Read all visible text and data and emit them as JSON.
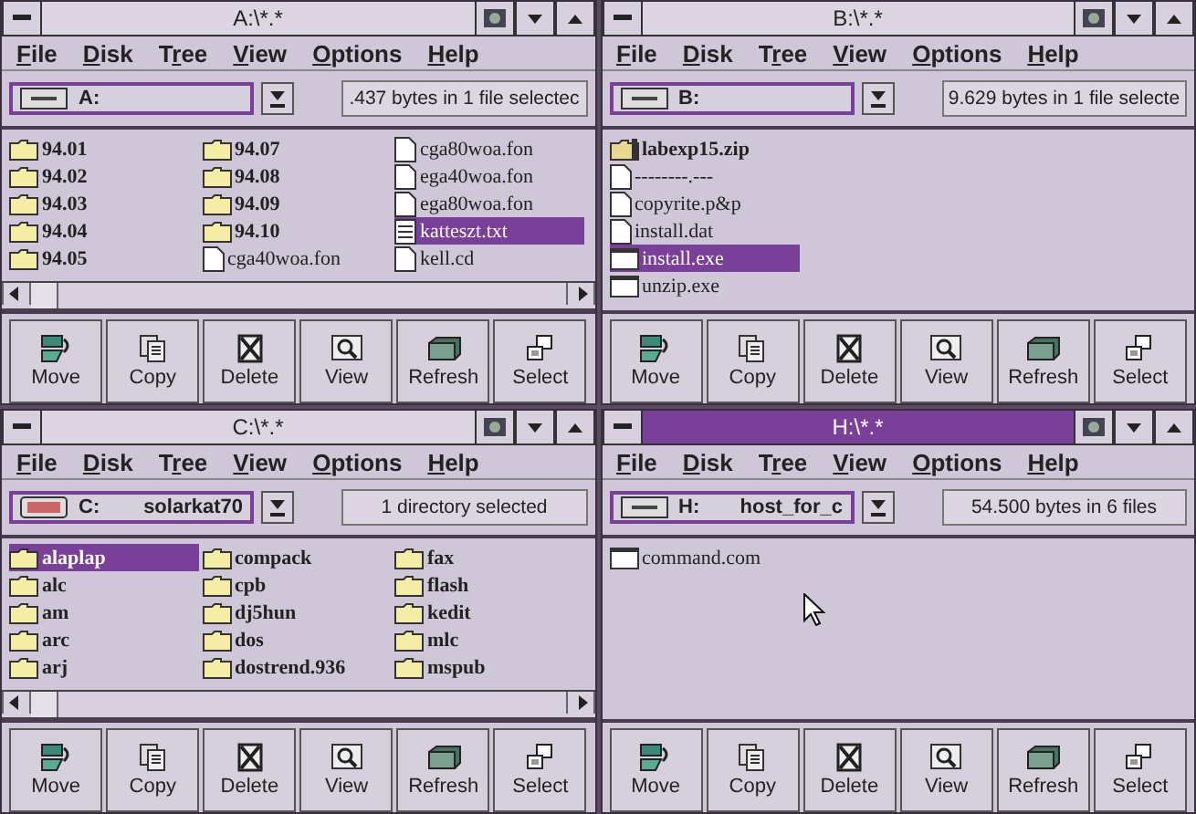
{
  "panes": [
    {
      "title": "A:\\*.*",
      "active": false,
      "menu": [
        {
          "key": "F",
          "post": "ile"
        },
        {
          "key": "D",
          "post": "isk"
        },
        {
          "pre": "T",
          "key": "r",
          "post": "ee"
        },
        {
          "key": "V",
          "post": "iew"
        },
        {
          "key": "O",
          "post": "ptions"
        },
        {
          "key": "H",
          "post": "elp"
        }
      ],
      "drive": {
        "letter": "A:",
        "kind": "floppy"
      },
      "status": ".437 bytes in 1 file selectec",
      "scrollbar": true,
      "pointer": false,
      "files": [
        {
          "name": "94.01",
          "kind": "folder",
          "selected": false
        },
        {
          "name": "94.02",
          "kind": "folder",
          "selected": false
        },
        {
          "name": "94.03",
          "kind": "folder",
          "selected": false
        },
        {
          "name": "94.04",
          "kind": "folder",
          "selected": false
        },
        {
          "name": "94.05",
          "kind": "folder",
          "selected": false
        },
        {
          "name": "94.07",
          "kind": "folder",
          "selected": false
        },
        {
          "name": "94.08",
          "kind": "folder",
          "selected": false
        },
        {
          "name": "94.09",
          "kind": "folder",
          "selected": false
        },
        {
          "name": "94.10",
          "kind": "folder",
          "selected": false
        },
        {
          "name": "cga40woa.fon",
          "kind": "doc",
          "selected": false
        },
        {
          "name": "cga80woa.fon",
          "kind": "doc",
          "selected": false
        },
        {
          "name": "ega40woa.fon",
          "kind": "doc",
          "selected": false
        },
        {
          "name": "ega80woa.fon",
          "kind": "doc",
          "selected": false
        },
        {
          "name": "katteszt.txt",
          "kind": "text",
          "selected": true
        },
        {
          "name": "kell.cd",
          "kind": "doc",
          "selected": false
        }
      ],
      "buttons": [
        "Move",
        "Copy",
        "Delete",
        "View",
        "Refresh",
        "Select"
      ]
    },
    {
      "title": "B:\\*.*",
      "active": false,
      "menu": [
        {
          "key": "F",
          "post": "ile"
        },
        {
          "key": "D",
          "post": "isk"
        },
        {
          "pre": "T",
          "key": "r",
          "post": "ee"
        },
        {
          "key": "V",
          "post": "iew"
        },
        {
          "key": "O",
          "post": "ptions"
        },
        {
          "key": "H",
          "post": "elp"
        }
      ],
      "drive": {
        "letter": "B:",
        "kind": "floppy"
      },
      "status": "9.629 bytes in 1 file selecte",
      "scrollbar": false,
      "pointer": false,
      "files": [
        {
          "name": "labexp15.zip",
          "kind": "zip",
          "selected": false
        },
        {
          "name": "--------.---",
          "kind": "doc",
          "selected": false
        },
        {
          "name": "copyrite.p&p",
          "kind": "doc",
          "selected": false
        },
        {
          "name": "install.dat",
          "kind": "doc",
          "selected": false
        },
        {
          "name": "install.exe",
          "kind": "exe",
          "selected": true
        },
        {
          "name": "unzip.exe",
          "kind": "exe",
          "selected": false
        }
      ],
      "buttons": [
        "Move",
        "Copy",
        "Delete",
        "View",
        "Refresh",
        "Select"
      ]
    },
    {
      "title": "C:\\*.*",
      "active": false,
      "menu": [
        {
          "key": "F",
          "post": "ile"
        },
        {
          "key": "D",
          "post": "isk"
        },
        {
          "pre": "T",
          "key": "r",
          "post": "ee"
        },
        {
          "key": "V",
          "post": "iew"
        },
        {
          "key": "O",
          "post": "ptions"
        },
        {
          "key": "H",
          "post": "elp"
        }
      ],
      "drive": {
        "letter": "C:",
        "label": "solarkat70",
        "kind": "network"
      },
      "status": "1 directory selected",
      "scrollbar": true,
      "pointer": false,
      "files": [
        {
          "name": "alaplap",
          "kind": "folder",
          "selected": true
        },
        {
          "name": "alc",
          "kind": "folder",
          "selected": false
        },
        {
          "name": "am",
          "kind": "folder",
          "selected": false
        },
        {
          "name": "arc",
          "kind": "folder",
          "selected": false
        },
        {
          "name": "arj",
          "kind": "folder",
          "selected": false
        },
        {
          "name": "compack",
          "kind": "folder",
          "selected": false
        },
        {
          "name": "cpb",
          "kind": "folder",
          "selected": false
        },
        {
          "name": "dj5hun",
          "kind": "folder",
          "selected": false
        },
        {
          "name": "dos",
          "kind": "folder",
          "selected": false
        },
        {
          "name": "dostrend.936",
          "kind": "folder",
          "selected": false
        },
        {
          "name": "fax",
          "kind": "folder",
          "selected": false
        },
        {
          "name": "flash",
          "kind": "folder",
          "selected": false
        },
        {
          "name": "kedit",
          "kind": "folder",
          "selected": false
        },
        {
          "name": "mlc",
          "kind": "folder",
          "selected": false
        },
        {
          "name": "mspub",
          "kind": "folder",
          "selected": false
        }
      ],
      "buttons": [
        "Move",
        "Copy",
        "Delete",
        "View",
        "Refresh",
        "Select"
      ]
    },
    {
      "title": "H:\\*.*",
      "active": true,
      "menu": [
        {
          "key": "F",
          "post": "ile"
        },
        {
          "key": "D",
          "post": "isk"
        },
        {
          "pre": "T",
          "key": "r",
          "post": "ee"
        },
        {
          "key": "V",
          "post": "iew"
        },
        {
          "key": "O",
          "post": "ptions"
        },
        {
          "key": "H",
          "post": "elp"
        }
      ],
      "drive": {
        "letter": "H:",
        "label": "host_for_c",
        "kind": "floppy"
      },
      "status": "54.500 bytes in 6 files",
      "scrollbar": false,
      "pointer": true,
      "files": [
        {
          "name": "command.com",
          "kind": "exe",
          "selected": false
        }
      ],
      "buttons": [
        "Move",
        "Copy",
        "Delete",
        "View",
        "Refresh",
        "Select"
      ]
    }
  ]
}
